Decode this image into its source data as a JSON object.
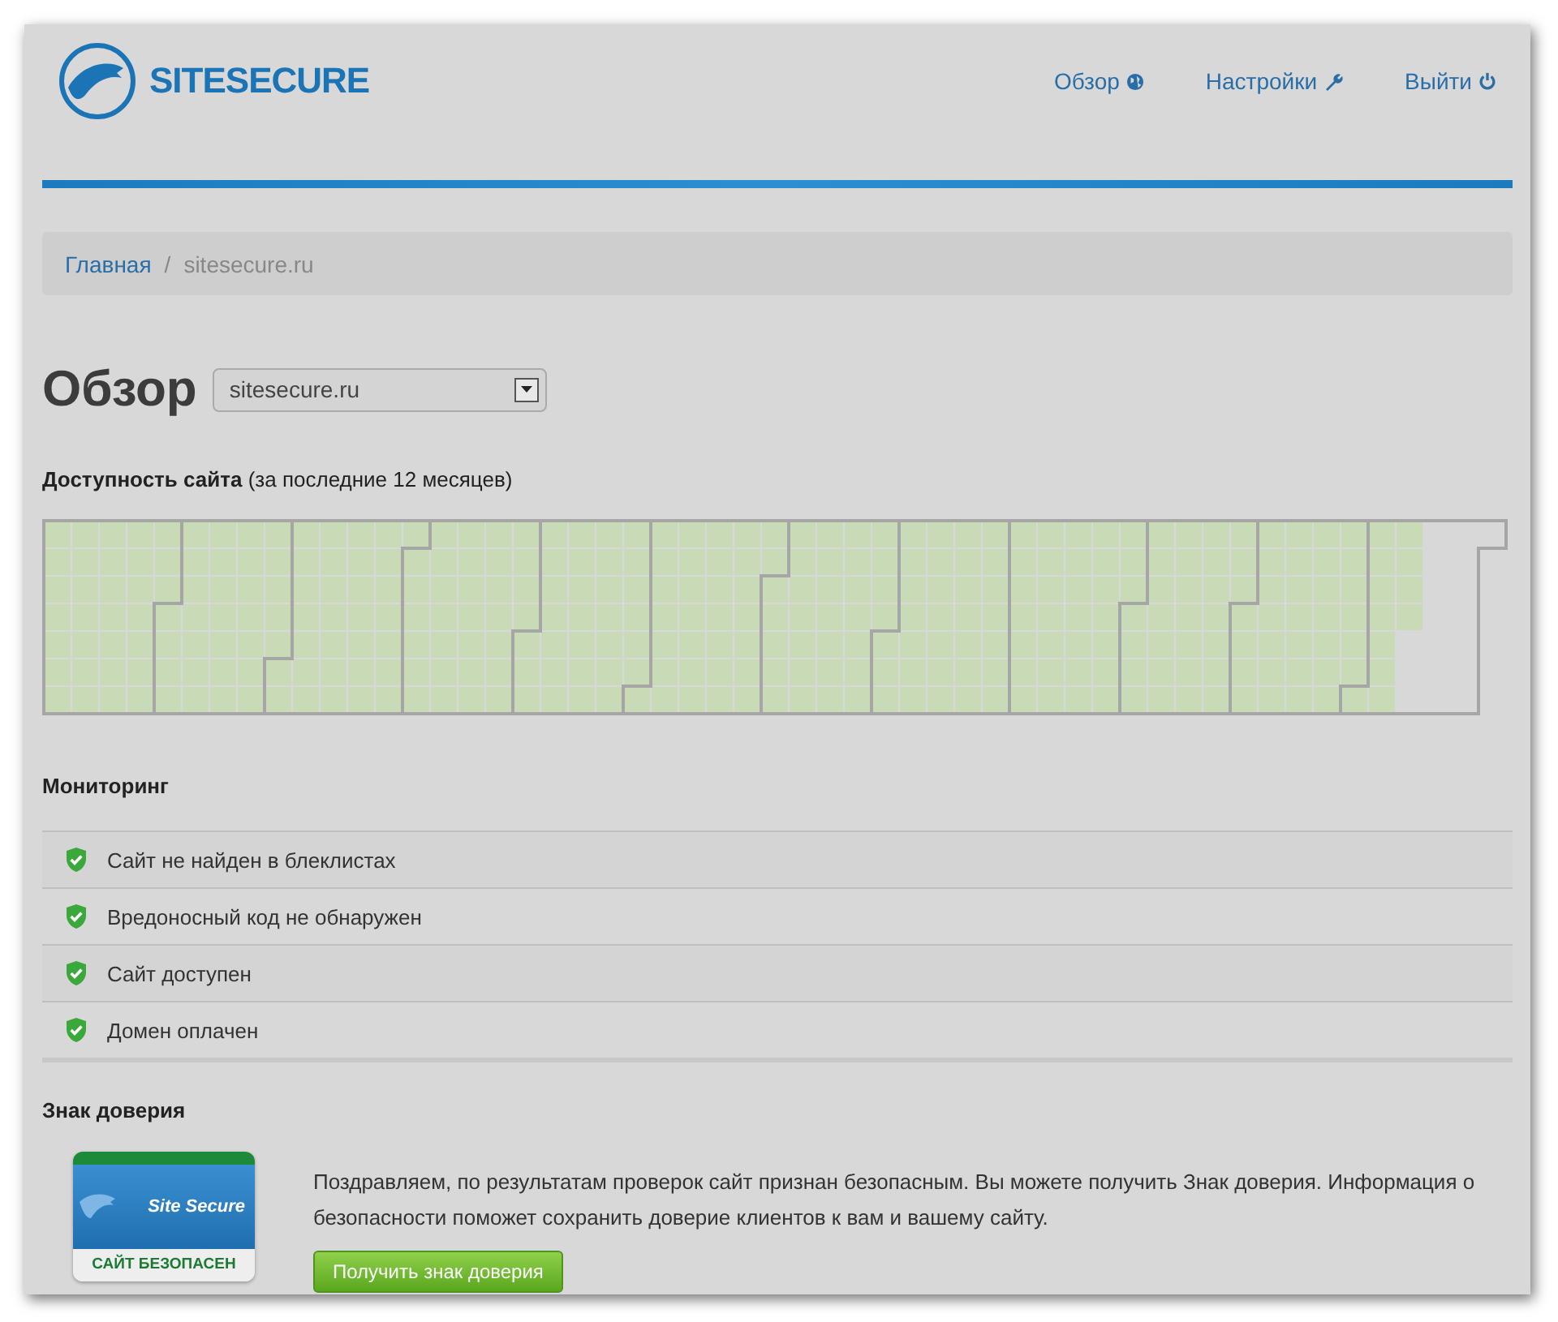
{
  "header": {
    "logo_text": "SITESECURE",
    "nav": [
      {
        "label": "Обзор"
      },
      {
        "label": "Настройки"
      },
      {
        "label": "Выйти"
      }
    ]
  },
  "breadcrumb": [
    {
      "label": "Главная",
      "kind": "link"
    },
    {
      "label": "/",
      "kind": "separator"
    },
    {
      "label": "sitesecure.ru",
      "kind": "current"
    }
  ],
  "overview": {
    "title": "Обзор",
    "site_select": {
      "value": "sitesecure.ru"
    }
  },
  "availability": {
    "heading": "**Доступность сайта** (за последние 12 месяцев)"
  },
  "monitoring": {
    "title": "Мониторинг",
    "items": [
      {
        "label": "Сайт не найден в блеклистах",
        "ok": true
      },
      {
        "label": "Вредоносный код не обнаружен",
        "ok": true
      },
      {
        "label": "Сайт доступен",
        "ok": true
      },
      {
        "label": "Домен оплачен",
        "ok": true
      }
    ]
  },
  "trust": {
    "title": "Знак доверия",
    "badge": {
      "brand": "Site Secure",
      "caption": "САЙТ БЕЗОПАСЕН"
    },
    "text": "Поздравляем, по результатам проверок сайт признан безопасным. Вы можете получить Знак доверия. Информация о безопасности поможет сохранить доверие клиентов к вам и вашему сайту.",
    "button": "Получить знак доверия"
  }
}
